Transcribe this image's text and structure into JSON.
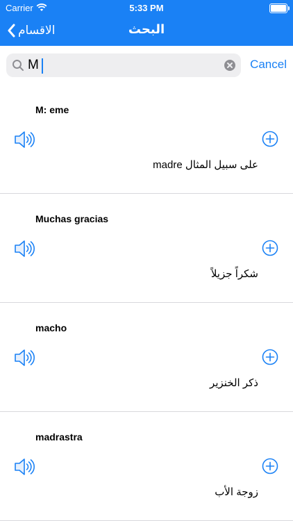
{
  "status": {
    "carrier": "Carrier",
    "time": "5:33 PM"
  },
  "nav": {
    "back_label": "الاقسام",
    "title": "البحث"
  },
  "search": {
    "value": "M",
    "cancel_label": "Cancel"
  },
  "results": [
    {
      "word": "M: eme",
      "meaning": "على سبيل المثال madre"
    },
    {
      "word": "Muchas gracias",
      "meaning": "شكراً جزيلاً"
    },
    {
      "word": "macho",
      "meaning": "ذكر الخنزير"
    },
    {
      "word": "madrastra",
      "meaning": "زوجة الأب"
    }
  ],
  "colors": {
    "accent": "#1a81f5"
  }
}
